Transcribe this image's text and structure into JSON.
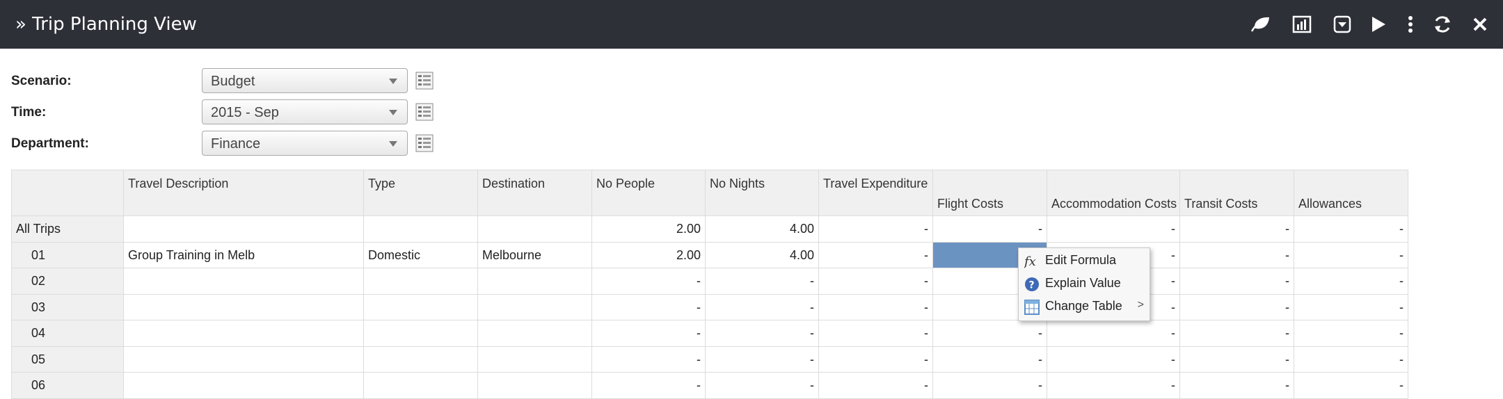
{
  "header": {
    "title": "» Trip Planning View",
    "icons": [
      "leaf-icon",
      "chart-icon",
      "dropdown-box-icon",
      "play-icon",
      "more-vertical-icon",
      "refresh-icon",
      "close-icon"
    ]
  },
  "filters": [
    {
      "label": "Scenario:",
      "value": "Budget"
    },
    {
      "label": "Time:",
      "value": "2015 - Sep"
    },
    {
      "label": "Department:",
      "value": "Finance"
    }
  ],
  "table": {
    "columns": [
      "Travel Description",
      "Type",
      "Destination",
      "No People",
      "No Nights",
      "Travel Expenditure",
      "Flight Costs",
      "Accommodation Costs",
      "Transit Costs",
      "Allowances"
    ],
    "rows": [
      {
        "label": "All Trips",
        "cells": [
          "",
          "",
          "",
          "2.00",
          "4.00",
          "-",
          "-",
          "-",
          "-",
          "-"
        ]
      },
      {
        "label": "01",
        "cells": [
          "Group Training in Melb",
          "Domestic",
          "Melbourne",
          "2.00",
          "4.00",
          "-",
          "",
          "-",
          "-",
          "-"
        ]
      },
      {
        "label": "02",
        "cells": [
          "",
          "",
          "",
          "-",
          "-",
          "-",
          "-",
          "-",
          "-",
          "-"
        ]
      },
      {
        "label": "03",
        "cells": [
          "",
          "",
          "",
          "-",
          "-",
          "-",
          "-",
          "-",
          "-",
          "-"
        ]
      },
      {
        "label": "04",
        "cells": [
          "",
          "",
          "",
          "-",
          "-",
          "-",
          "-",
          "-",
          "-",
          "-"
        ]
      },
      {
        "label": "05",
        "cells": [
          "",
          "",
          "",
          "-",
          "-",
          "-",
          "-",
          "-",
          "-",
          "-"
        ]
      },
      {
        "label": "06",
        "cells": [
          "",
          "",
          "",
          "-",
          "-",
          "-",
          "-",
          "-",
          "-",
          "-"
        ]
      }
    ]
  },
  "context_menu": {
    "items": [
      {
        "label": "Edit Formula",
        "icon": "fx-icon"
      },
      {
        "label": "Explain Value",
        "icon": "help-icon"
      },
      {
        "label": "Change Table",
        "icon": "table-icon",
        "submenu": ">"
      }
    ]
  },
  "colors": {
    "header_bg": "#2e3038",
    "selection": "#6b93c2",
    "grid_header": "#f0f0f0"
  }
}
